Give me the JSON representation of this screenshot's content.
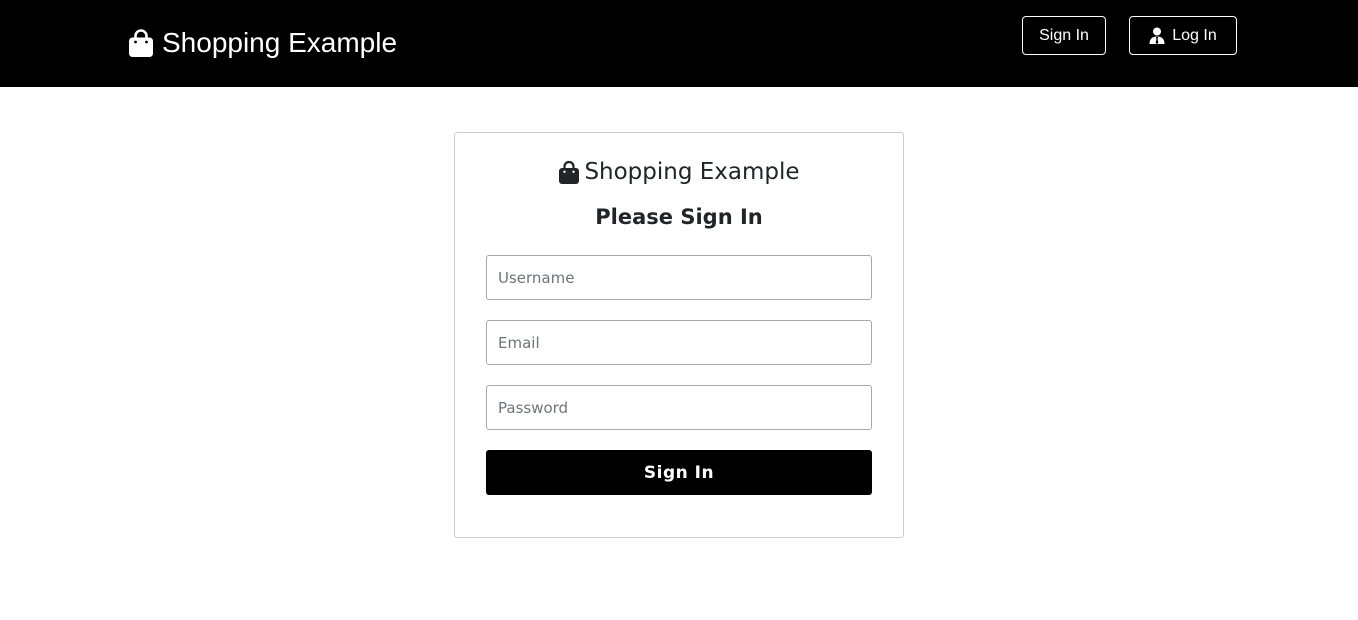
{
  "navbar": {
    "brand": {
      "icon": "shopping-bag-icon",
      "label": "Shopping Example"
    },
    "sign_in_label": "Sign In",
    "log_in": {
      "icon": "user-icon",
      "label": "Log In"
    }
  },
  "form": {
    "brand": {
      "icon": "shopping-bag-icon",
      "label": "Shopping Example"
    },
    "heading": "Please Sign In",
    "username": {
      "placeholder": "Username",
      "value": ""
    },
    "email": {
      "placeholder": "Email",
      "value": ""
    },
    "password": {
      "placeholder": "Password",
      "value": ""
    },
    "submit_label": "Sign In"
  },
  "colors": {
    "navbar_background": "#000000",
    "primary_button": "#000000",
    "text": "#212529",
    "card_border": "#cccccc"
  }
}
